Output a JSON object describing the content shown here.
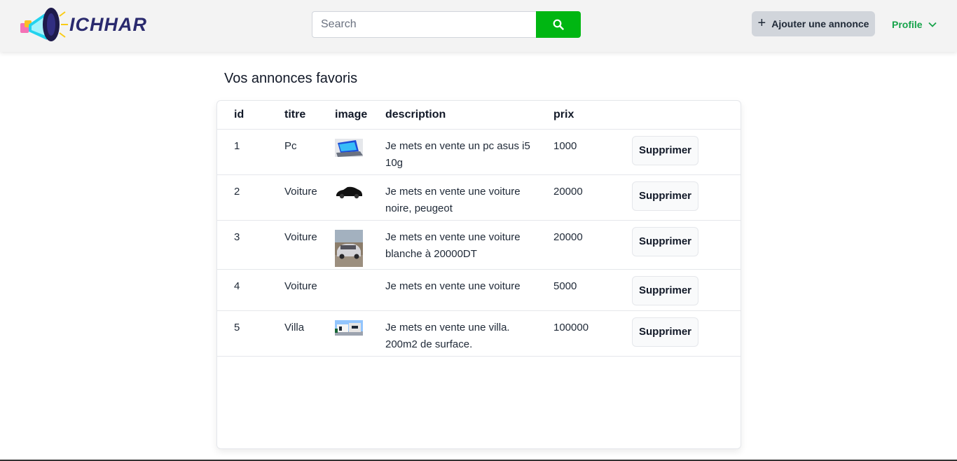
{
  "header": {
    "logo_text": "ICHHAR",
    "search_placeholder": "Search",
    "add_button_label": "Ajouter une annonce",
    "profile_label": "Profile",
    "accent_color": "#00b612"
  },
  "main": {
    "title": "Vos annonces favoris",
    "columns": {
      "id": "id",
      "titre": "titre",
      "image": "image",
      "description": "description",
      "prix": "prix"
    },
    "rows": [
      {
        "id": "1",
        "titre": "Pc",
        "image": "laptop",
        "description": "Je mets en vente un pc asus i5 10g",
        "prix": "1000",
        "action": "Supprimer"
      },
      {
        "id": "2",
        "titre": "Voiture",
        "image": "black-car",
        "description": "Je mets en vente une voiture noire, peugeot",
        "prix": "20000",
        "action": "Supprimer"
      },
      {
        "id": "3",
        "titre": "Voiture",
        "image": "white-car",
        "description": "Je mets en vente une voiture blanche à 20000DT",
        "prix": "20000",
        "action": "Supprimer"
      },
      {
        "id": "4",
        "titre": "Voiture",
        "image": "",
        "description": "Je mets en vente une voiture",
        "prix": "5000",
        "action": "Supprimer"
      },
      {
        "id": "5",
        "titre": "Villa",
        "image": "villa",
        "description": "Je mets en vente une villa. 200m2 de surface.",
        "prix": "100000",
        "action": "Supprimer"
      }
    ]
  }
}
